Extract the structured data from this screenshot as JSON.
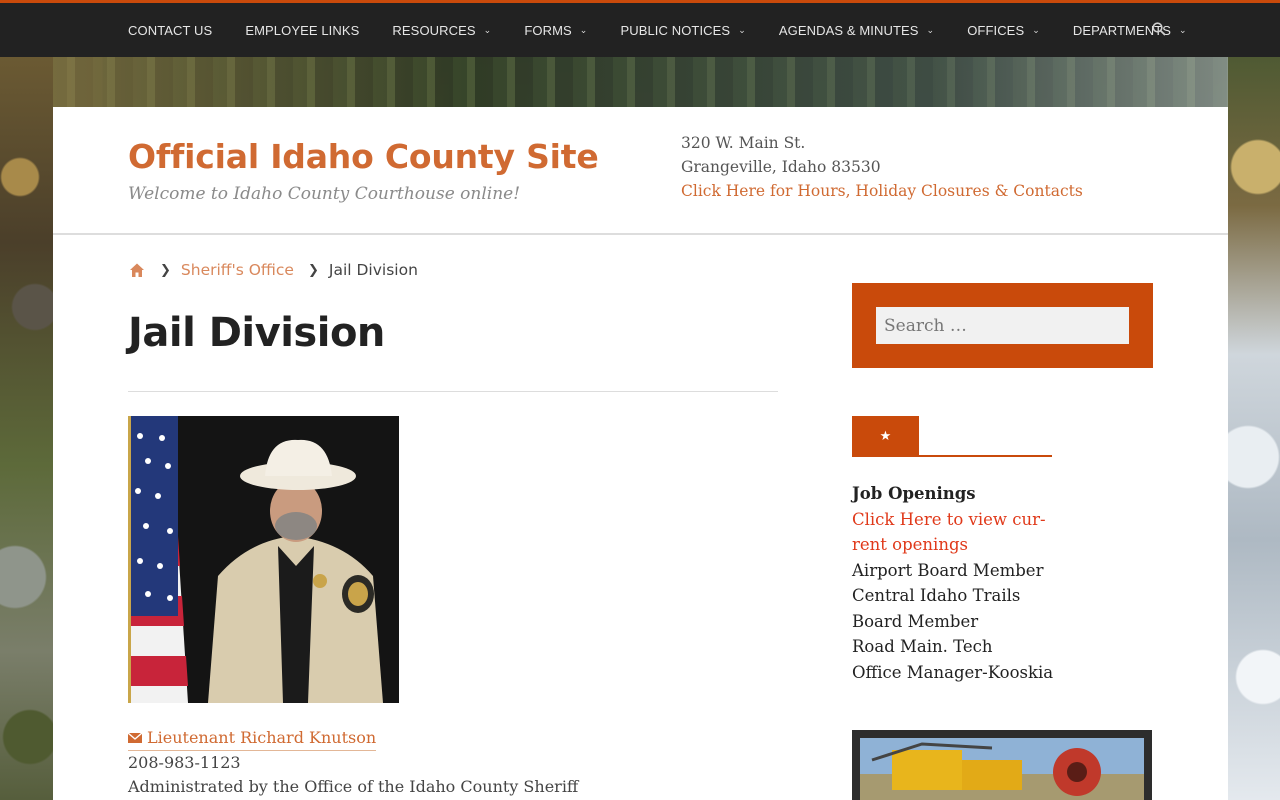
{
  "nav": {
    "items": [
      {
        "label": "CONTACT US",
        "dropdown": false
      },
      {
        "label": "EMPLOYEE LINKS",
        "dropdown": false
      },
      {
        "label": "RESOURCES",
        "dropdown": true
      },
      {
        "label": "FORMS",
        "dropdown": true
      },
      {
        "label": "PUBLIC NOTICES",
        "dropdown": true
      },
      {
        "label": "AGENDAS & MINUTES",
        "dropdown": true
      },
      {
        "label": "OFFICES",
        "dropdown": true
      },
      {
        "label": "DEPARTMENTS",
        "dropdown": true
      }
    ],
    "search_icon": "search-icon"
  },
  "header": {
    "title": "Official Idaho County Site",
    "tagline": "Welcome to Idaho County Courthouse online!",
    "address_line1": "320 W. Main St.",
    "address_line2": "Grangeville, Idaho 83530",
    "hours_link": "Click Here for Hours, Holiday Closures & Contacts"
  },
  "breadcrumb": {
    "home_icon": "home-icon",
    "parent": "Sheriff's Office",
    "current": "Jail Division"
  },
  "main": {
    "title": "Jail Division",
    "contact_name": "Lieutenant Richard Knutson",
    "phone": "208-983-1123",
    "admin_note": "Administrated by the Office of the Idaho County Sheriff"
  },
  "sidebar": {
    "search_placeholder": "Search …",
    "star_icon": "star-icon",
    "jobs_heading": "Job Openings",
    "jobs_link_line1": "Click Here to view cur-",
    "jobs_link_line2": "rent openings",
    "job_items": [
      "Airport Board Member",
      "Central Idaho Trails",
      "Board Member",
      "Road Main. Tech",
      "Office Manager-Kooskia"
    ]
  },
  "colors": {
    "accent": "#c94a0b",
    "title_orange": "#d06a32",
    "link_red": "#e0391a",
    "nav_bg": "#222222"
  }
}
